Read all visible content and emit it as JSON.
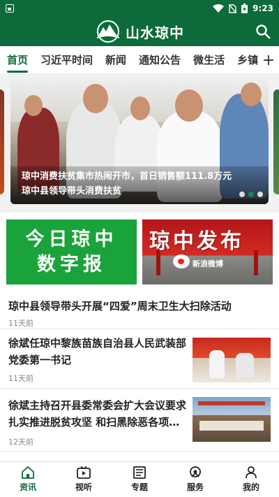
{
  "status_bar": {
    "time": "9:23"
  },
  "header": {
    "title": "山水琼中"
  },
  "tabs": [
    {
      "label": "首页",
      "active": true
    },
    {
      "label": "习近平时间"
    },
    {
      "label": "新闻"
    },
    {
      "label": "通知公告"
    },
    {
      "label": "微生活"
    },
    {
      "label": "乡镇"
    }
  ],
  "carousel": {
    "caption_line1": "琼中消费扶贫集市热闹开市，首日销售额111.8万元",
    "caption_line2": "琼中县领导带头消费扶贫",
    "slide_count": 3,
    "active_index": 1
  },
  "banners": {
    "left_line1": "今日琼中",
    "left_line2": "数字报",
    "right_title": "琼中发布",
    "right_sub": "新浪微博"
  },
  "news": [
    {
      "title": "琼中县领导带头开展“四爱”周末卫生大扫除活动",
      "time": "11天前"
    },
    {
      "title_line1": "徐斌任琼中黎族苗族自治县人民武装部",
      "title_line2": "党委第一书记",
      "time": "11天前"
    },
    {
      "title_line1": "徐斌主持召开县委常委会扩大会议要求",
      "title_line2": "扎实推进脱贫攻坚 和扫黑除恶各项…",
      "time": "12天前"
    }
  ],
  "bottom_nav": [
    {
      "label": "资讯",
      "icon": "home-icon",
      "active": true
    },
    {
      "label": "视听",
      "icon": "video-icon"
    },
    {
      "label": "专题",
      "icon": "newspaper-icon"
    },
    {
      "label": "服务",
      "icon": "service-icon"
    },
    {
      "label": "我的",
      "icon": "user-icon"
    }
  ],
  "colors": {
    "brand": "#0d6b3b",
    "accent_banner": "#1aa33a"
  }
}
